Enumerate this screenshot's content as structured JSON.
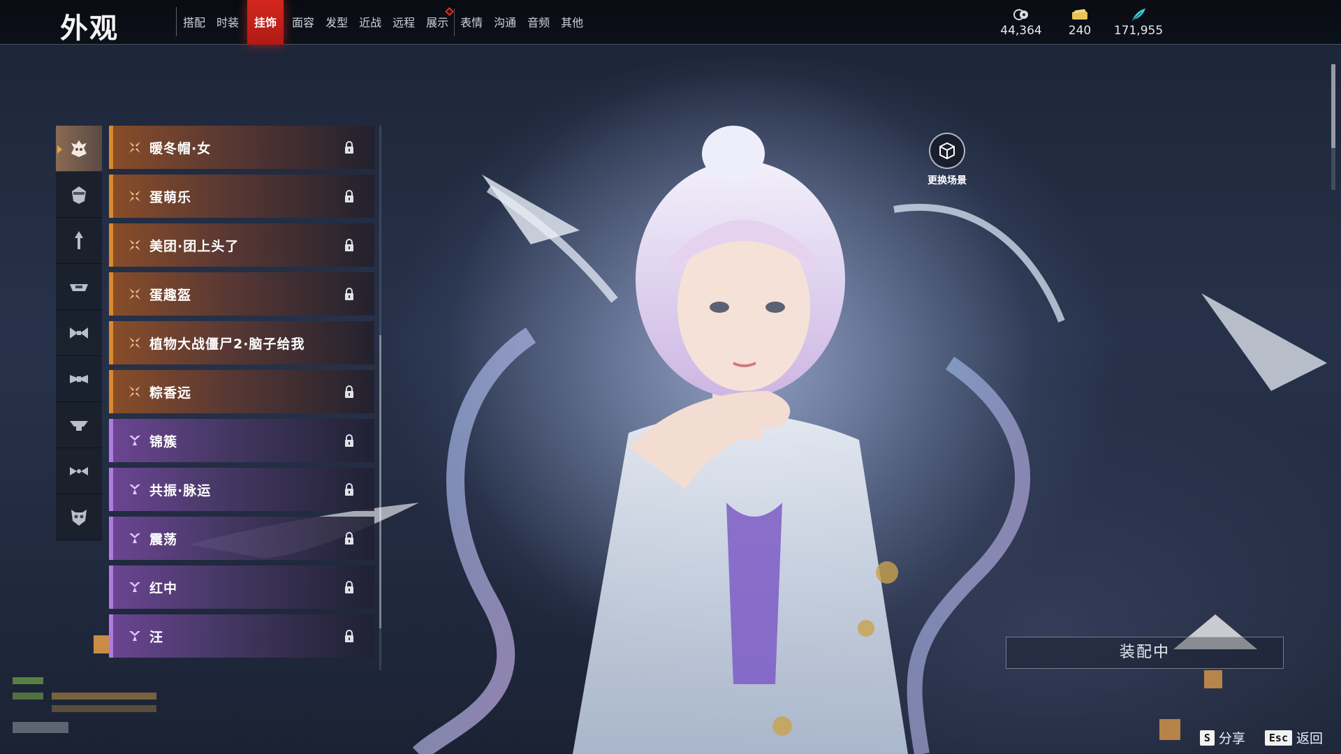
{
  "header": {
    "title": "外观",
    "tabs": [
      {
        "label": "搭配",
        "active": false
      },
      {
        "label": "时装",
        "active": false
      },
      {
        "label": "挂饰",
        "active": true
      },
      {
        "label": "面容",
        "active": false
      },
      {
        "label": "发型",
        "active": false
      },
      {
        "label": "近战",
        "active": false
      },
      {
        "label": "远程",
        "active": false
      },
      {
        "label": "展示",
        "active": false,
        "badge": true
      },
      {
        "label": "表情",
        "active": false
      },
      {
        "label": "沟通",
        "active": false
      },
      {
        "label": "音频",
        "active": false
      },
      {
        "label": "其他",
        "active": false
      }
    ]
  },
  "currencies": [
    {
      "icon": "coin-icon",
      "value": "44,364"
    },
    {
      "icon": "ticket-icon",
      "value": "240"
    },
    {
      "icon": "feather-icon",
      "value": "171,955"
    }
  ],
  "categories": [
    {
      "icon": "head-ornament-icon",
      "active": true
    },
    {
      "icon": "face-ornament-icon",
      "active": false
    },
    {
      "icon": "hair-pin-icon",
      "active": false
    },
    {
      "icon": "hat-brim-icon",
      "active": false
    },
    {
      "icon": "bow-icon",
      "active": false
    },
    {
      "icon": "waist-ornament-icon",
      "active": false
    },
    {
      "icon": "back-ornament-icon",
      "active": false
    },
    {
      "icon": "wing-ornament-icon",
      "active": false
    },
    {
      "icon": "mask-icon",
      "active": false
    }
  ],
  "items": [
    {
      "name": "暖冬帽·女",
      "rarity": "orange",
      "locked": true
    },
    {
      "name": "蛋萌乐",
      "rarity": "orange",
      "locked": true
    },
    {
      "name": "美团·团上头了",
      "rarity": "orange",
      "locked": true
    },
    {
      "name": "蛋趣盔",
      "rarity": "orange",
      "locked": true
    },
    {
      "name": "植物大战僵尸2·脑子给我",
      "rarity": "orange",
      "locked": false
    },
    {
      "name": "粽香远",
      "rarity": "orange",
      "locked": true
    },
    {
      "name": "锦簇",
      "rarity": "purple",
      "locked": true
    },
    {
      "name": "共振·脉运",
      "rarity": "purple",
      "locked": true
    },
    {
      "name": "震荡",
      "rarity": "purple",
      "locked": true
    },
    {
      "name": "红中",
      "rarity": "purple",
      "locked": true
    },
    {
      "name": "汪",
      "rarity": "purple",
      "locked": true
    }
  ],
  "scene_button": {
    "label": "更换场景"
  },
  "equip_status": "装配中",
  "hints": [
    {
      "key": "S",
      "label": "分享"
    },
    {
      "key": "Esc",
      "label": "返回"
    }
  ],
  "colors": {
    "active_tab": "#d3271e",
    "legendary": "#d9892e",
    "epic": "#b07ae0"
  }
}
